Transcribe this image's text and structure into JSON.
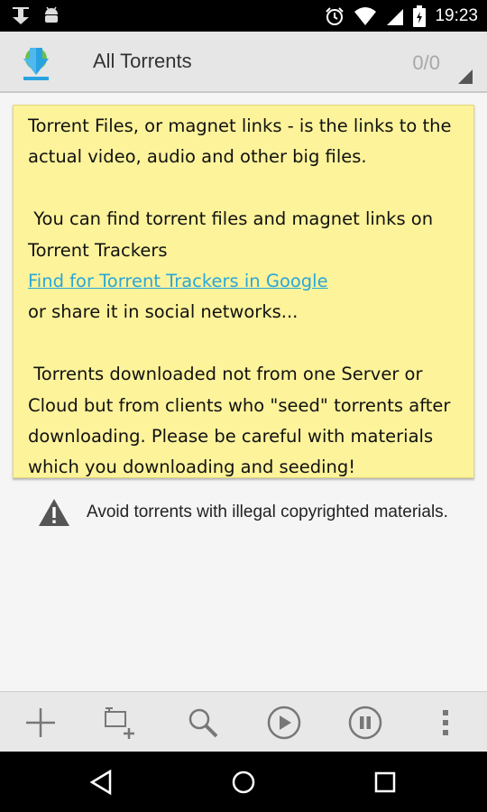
{
  "status_bar": {
    "time": "19:23",
    "left_icons": [
      "download-notification-icon",
      "android-icon"
    ],
    "right_icons": [
      "alarm-icon",
      "wifi-icon",
      "signal-icon",
      "battery-icon"
    ]
  },
  "action_bar": {
    "title": "All Torrents",
    "counter": "0/0",
    "app_icon": "download-arrow-icon"
  },
  "note": {
    "para1": "Torrent Files, or magnet links - is the links to the actual video, audio and other big files.",
    "para2_prefix": " You can find torrent files and magnet links on Torrent Trackers",
    "link_text": "Find for Torrent Trackers in Google",
    "para2_suffix": "or share it in social networks...",
    "para3": " Torrents downloaded not from one Server or Cloud but from clients who \"seed\" torrents after downloading. Please be careful with materials which you downloading and seeding!"
  },
  "warning": {
    "text": "Avoid torrents with illegal copyrighted materials.",
    "icon": "warning-triangle-icon"
  },
  "bottom_toolbar": {
    "buttons": [
      "add-icon",
      "add-from-file-icon",
      "search-icon",
      "play-icon",
      "pause-icon",
      "overflow-menu-icon"
    ]
  },
  "nav_bar": {
    "buttons": [
      "back-icon",
      "home-icon",
      "recents-icon"
    ]
  },
  "colors": {
    "note_background": "#fdf39a",
    "link": "#2aa7d8",
    "app_icon_blue": "#29a3e0",
    "action_bar": "#e6e6e6"
  }
}
